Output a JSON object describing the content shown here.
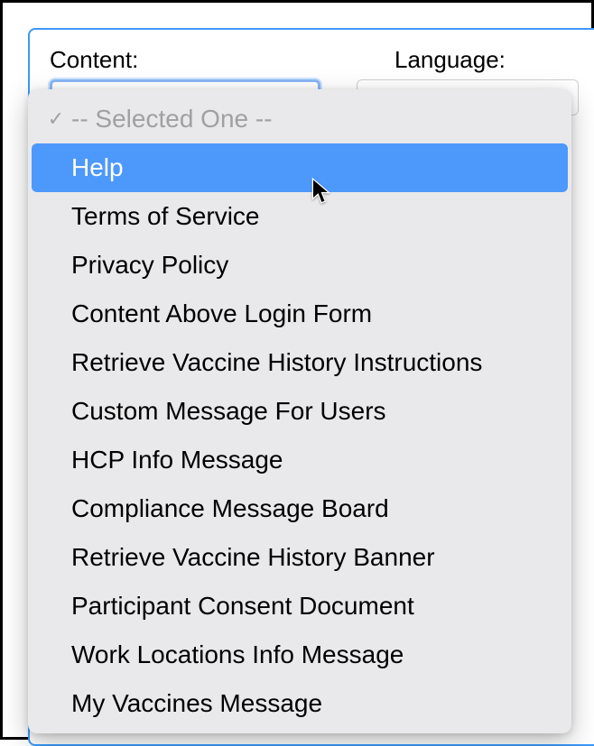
{
  "form": {
    "content_label": "Content:",
    "language_label": "Language:"
  },
  "dropdown": {
    "placeholder": "-- Selected One --",
    "checkmark": "✓",
    "items": [
      "Help",
      "Terms of Service",
      "Privacy Policy",
      "Content Above Login Form",
      "Retrieve Vaccine History Instructions",
      "Custom Message For Users",
      "HCP Info Message",
      "Compliance Message Board",
      "Retrieve Vaccine History Banner",
      "Participant Consent Document",
      "Work Locations Info Message",
      "My Vaccines Message"
    ],
    "highlighted_index": 0
  }
}
